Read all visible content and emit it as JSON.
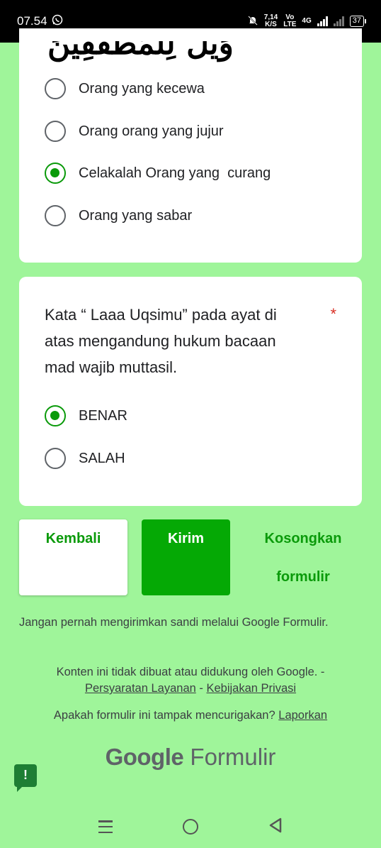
{
  "status_bar": {
    "time": "07.54",
    "speed_value": "7,14",
    "speed_unit": "K/S",
    "volte_top": "Vo",
    "volte_bottom": "LTE",
    "network": "4G",
    "battery": "37"
  },
  "question1": {
    "arabic_text": "وَيْلٌ لِلْمُطَفِّفِينَ",
    "options": [
      {
        "label": "Orang yang kecewa",
        "checked": false
      },
      {
        "label": "Orang orang yang jujur",
        "checked": false
      },
      {
        "label": "Celakalah Orang yang  curang",
        "checked": true
      },
      {
        "label": "Orang yang sabar",
        "checked": false
      }
    ]
  },
  "question2": {
    "text": "Kata “ Laaa Uqsimu” pada ayat di atas mengandung hukum bacaan mad wajib muttasil.",
    "required_mark": "*",
    "options": [
      {
        "label": "BENAR",
        "checked": true
      },
      {
        "label": "SALAH",
        "checked": false
      }
    ]
  },
  "buttons": {
    "back": "Kembali",
    "submit": "Kirim",
    "clear": "Kosongkan formulir"
  },
  "footer": {
    "password_warning": "Jangan pernah mengirimkan sandi melalui Google Formulir.",
    "disclaimer": "Konten ini tidak dibuat atau didukung oleh Google. -",
    "terms_link": "Persyaratan Layanan",
    "separator": "-",
    "privacy_link": "Kebijakan Privasi",
    "report_question": "Apakah formulir ini tampak mencurigakan?",
    "report_link": "Laporkan",
    "brand_google": "Google",
    "brand_forms": "Formulir"
  },
  "accent_color": "#0a9a0a",
  "background_color": "#9ff59a"
}
